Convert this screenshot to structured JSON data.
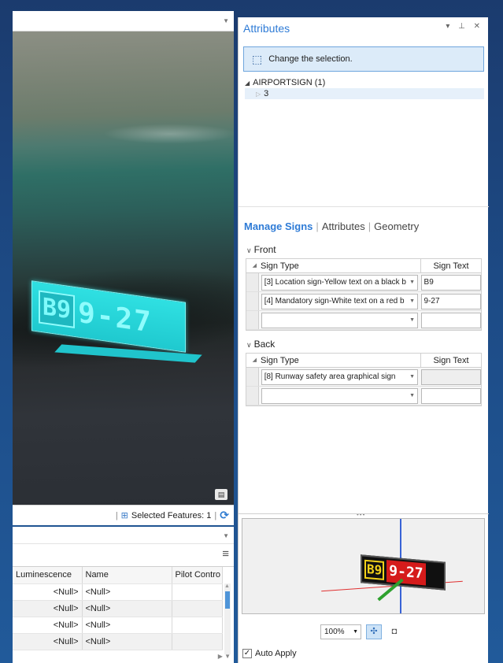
{
  "scene": {
    "sign_location_text": "B9",
    "sign_runway_text": "9-27"
  },
  "status_bar": {
    "selected_features": "Selected Features: 1"
  },
  "table": {
    "columns": [
      "Luminescence",
      "Name",
      "Pilot Contro"
    ],
    "rows": [
      [
        "<Null>",
        "<Null>",
        ""
      ],
      [
        "<Null>",
        "<Null>",
        ""
      ],
      [
        "<Null>",
        "<Null>",
        ""
      ],
      [
        "<Null>",
        "<Null>",
        ""
      ]
    ]
  },
  "attributes_pane": {
    "title": "Attributes",
    "controls": "▾ ⊥ ✕",
    "change_selection": "Change the selection.",
    "tree": {
      "layer": "AIRPORTSIGN (1)",
      "feature": "3"
    },
    "tabs": {
      "manage_signs": "Manage Signs",
      "attributes": "Attributes",
      "geometry": "Geometry"
    },
    "front": {
      "header": "Front",
      "col_type": "Sign Type",
      "col_text": "Sign Text",
      "rows": [
        {
          "type": "[3] Location sign-Yellow text on a black b",
          "text": "B9"
        },
        {
          "type": "[4] Mandatory sign-White text on a red b",
          "text": "9-27"
        },
        {
          "type": "",
          "text": ""
        }
      ]
    },
    "back": {
      "header": "Back",
      "col_type": "Sign Type",
      "col_text": "Sign Text",
      "rows": [
        {
          "type": "[8] Runway safety area graphical sign",
          "text": ""
        },
        {
          "type": "",
          "text": ""
        }
      ]
    },
    "preview": {
      "sign_location_text": "B9",
      "sign_runway_text": "9-27"
    },
    "zoom": "100%",
    "auto_apply": "Auto Apply"
  },
  "colors": {
    "accent": "#2e7bd6",
    "cyan_sign": "#2fe0e2",
    "yellow_text": "#f4d21a",
    "red_background": "#d51b1b"
  }
}
